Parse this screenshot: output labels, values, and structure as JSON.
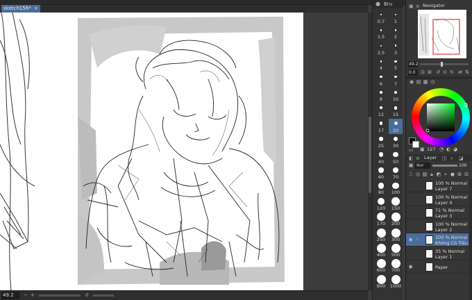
{
  "document_tab": {
    "title": "sketch156*",
    "close": "×"
  },
  "status": {
    "zoom": "49.2"
  },
  "brush_panel": {
    "title": "Bru",
    "sizes": [
      {
        "label": "0.7"
      },
      {
        "label": "1"
      },
      {
        "label": "1.5"
      },
      {
        "label": "2"
      },
      {
        "label": "2.5"
      },
      {
        "label": "3"
      },
      {
        "label": "4"
      },
      {
        "label": "5"
      },
      {
        "label": "6"
      },
      {
        "label": "7"
      },
      {
        "label": "8"
      },
      {
        "label": "10"
      },
      {
        "label": "12"
      },
      {
        "label": "15"
      },
      {
        "label": "17"
      },
      {
        "label": "20"
      },
      {
        "label": "25"
      },
      {
        "label": "30"
      },
      {
        "label": "40"
      },
      {
        "label": "50"
      },
      {
        "label": "60"
      },
      {
        "label": "70"
      },
      {
        "label": "80"
      },
      {
        "label": "100"
      },
      {
        "label": "120"
      },
      {
        "label": "150"
      },
      {
        "label": "170"
      },
      {
        "label": "200"
      },
      {
        "label": "250"
      },
      {
        "label": "300"
      },
      {
        "label": "400"
      },
      {
        "label": "500"
      },
      {
        "label": "600"
      },
      {
        "label": "700"
      },
      {
        "label": "800"
      },
      {
        "label": "1000"
      }
    ],
    "selected_size": "20"
  },
  "navigator": {
    "title": "Navigator",
    "zoom_value": "49.2",
    "rotation_value": "0.0"
  },
  "color": {
    "value": "127",
    "main_color": "#0a0a0a",
    "sub_color": "#ffffff"
  },
  "layer_panel": {
    "title": "Layer",
    "blend_mode": "Nor",
    "opacity": "100",
    "layers": [
      {
        "line1": "100 % Normal",
        "line2": "Layer 7",
        "visible": false,
        "selected": false
      },
      {
        "line1": "100 % Normal",
        "line2": "Layer 4",
        "visible": false,
        "selected": false
      },
      {
        "line1": "71 % Normal",
        "line2": "Layer 3",
        "visible": false,
        "selected": false
      },
      {
        "line1": "100 % Normal",
        "line2": "Layer 2",
        "visible": false,
        "selected": false
      },
      {
        "line1": "100 % Normal",
        "line2": "Không Có Tiêu Đề-",
        "visible": true,
        "selected": true
      },
      {
        "line1": "35 % Normal",
        "line2": "Layer 1",
        "visible": false,
        "selected": false
      },
      {
        "line1": "",
        "line2": "Paper",
        "visible": true,
        "selected": false
      }
    ]
  },
  "icons": {
    "navigator_icon": "navigator-icon",
    "brush_icon": "brush-size-icon",
    "layer_icon": "layer-icon",
    "eye_icon": "eye-icon",
    "lock_icon": "lock-icon"
  },
  "colors": {
    "selection_blue": "#4a6d9b",
    "panel_bg": "#363636",
    "canvas_bg": "#3c3c3c"
  }
}
